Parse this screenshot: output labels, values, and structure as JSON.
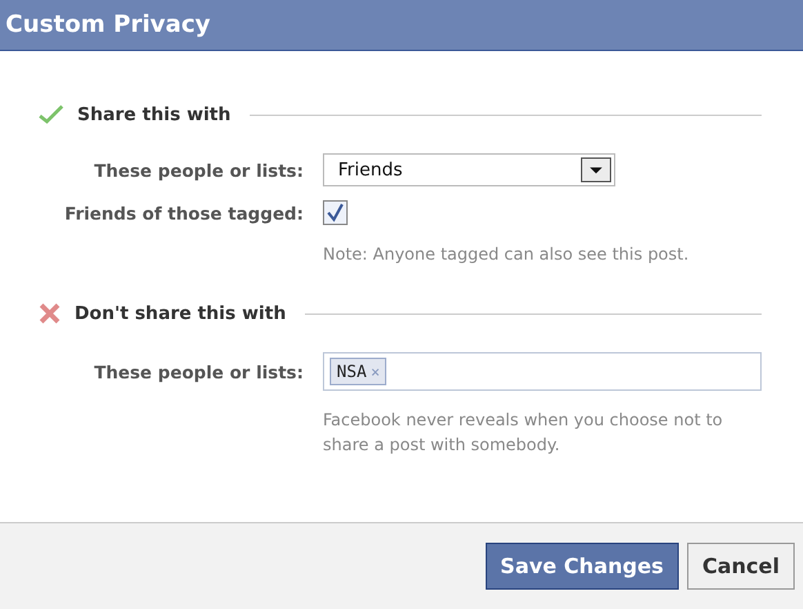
{
  "dialog": {
    "title": "Custom Privacy"
  },
  "sections": [
    {
      "kind": "allow",
      "heading": "Share this with",
      "rows": [
        {
          "kind": "select",
          "label": "These people or lists:",
          "value": "Friends"
        },
        {
          "kind": "checkbox",
          "label": "Friends of those tagged:",
          "checked": true
        }
      ],
      "note": "Note: Anyone tagged can also see this post."
    },
    {
      "kind": "deny",
      "heading": "Don't share this with",
      "rows": [
        {
          "kind": "tokens",
          "label": "These people or lists:",
          "tokens": [
            {
              "text": "NSA",
              "remove": "×"
            }
          ]
        }
      ],
      "note": "Facebook never reveals when you choose not to share a post with somebody."
    }
  ],
  "buttons": [
    {
      "kind": "primary",
      "label": "Save Changes"
    },
    {
      "kind": "secondary",
      "label": "Cancel"
    }
  ]
}
